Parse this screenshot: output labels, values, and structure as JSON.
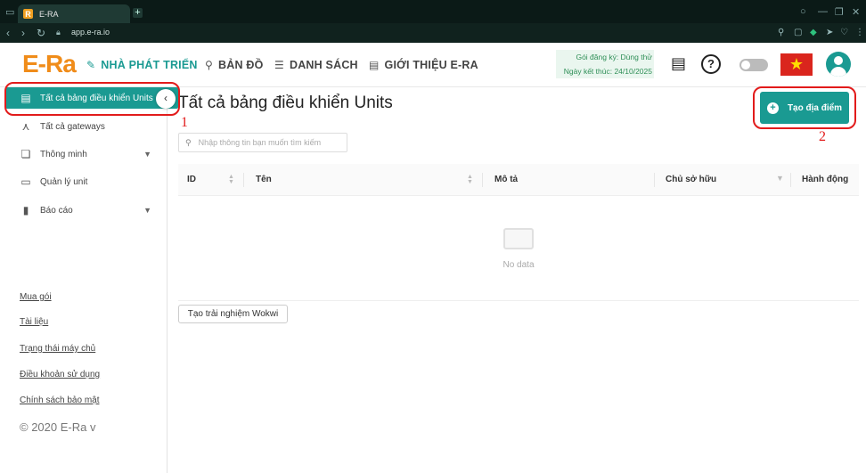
{
  "browser": {
    "tab_title": "E-RA",
    "url": "app.e-ra.io"
  },
  "header": {
    "logo": "E-Ra",
    "nav": [
      {
        "label": "NHÀ PHÁT TRIỂN",
        "icon": "wrench-icon",
        "active": true
      },
      {
        "label": "BẢN ĐỒ",
        "icon": "map-pin-icon",
        "active": false
      },
      {
        "label": "DANH SÁCH",
        "icon": "list-icon",
        "active": false
      },
      {
        "label": "GIỚI THIỆU E-RA",
        "icon": "newspaper-icon",
        "active": false
      }
    ],
    "plan_line1": "Gói đăng ký: Dùng thử",
    "plan_line2": "Ngày kết thúc: 24/10/2025"
  },
  "sidebar": {
    "items": [
      {
        "label": "Tất cả bảng điều khiển Units",
        "icon": "dashboard-icon"
      },
      {
        "label": "Tất cả gateways",
        "icon": "gateway-icon"
      },
      {
        "label": "Thông minh",
        "icon": "smart-icon"
      },
      {
        "label": "Quản lý unit",
        "icon": "unit-icon"
      },
      {
        "label": "Báo cáo",
        "icon": "report-icon"
      }
    ],
    "links": [
      "Mua gói",
      "Tài liệu",
      "Trạng thái máy chủ",
      "Điều khoản sử dụng",
      "Chính sách bảo mật"
    ],
    "copyright": "© 2020 E-Ra v"
  },
  "main": {
    "title": "Tất cả bảng điều khiển Units",
    "add_button": "Tạo địa điểm",
    "search_placeholder": "Nhập thông tin bạn muốn tìm kiếm",
    "columns": [
      "ID",
      "Tên",
      "Mô tả",
      "Chủ sở hữu",
      "Hành động"
    ],
    "empty_text": "No data",
    "wokwi_button": "Tạo trải nghiệm Wokwi"
  },
  "annotations": {
    "label1": "1",
    "label2": "2"
  },
  "colors": {
    "accent": "#1a9a92",
    "logo": "#f08c1a",
    "annotation": "#e21b1b"
  }
}
